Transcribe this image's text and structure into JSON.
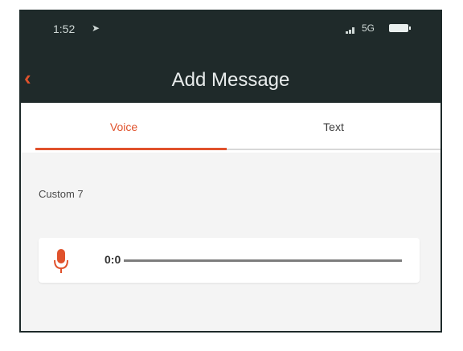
{
  "status_bar": {
    "time": "1:52",
    "location_icon": "location-arrow-icon",
    "network": "5G",
    "battery_icon": "battery-icon"
  },
  "header": {
    "back_icon": "chevron-left-icon",
    "title": "Add Message"
  },
  "tabs": [
    {
      "label": "Voice",
      "active": true
    },
    {
      "label": "Text",
      "active": false
    }
  ],
  "message": {
    "name": "Custom 7",
    "duration": "0:0",
    "mic_icon": "microphone-icon"
  },
  "colors": {
    "accent": "#e0522c",
    "header_bg": "#1f2a2a",
    "page_bg": "#f4f4f4"
  }
}
